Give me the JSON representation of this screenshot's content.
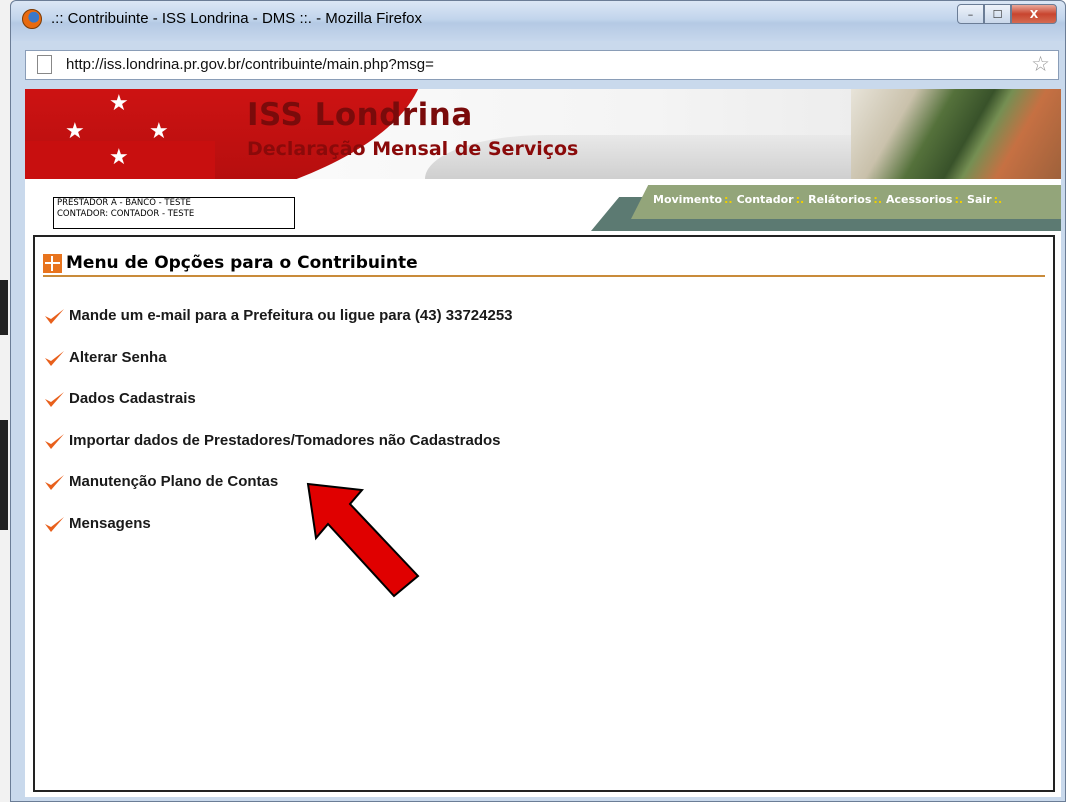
{
  "window": {
    "title": ".:: Contribuinte - ISS Londrina - DMS ::. - Mozilla Firefox",
    "min_label": "–",
    "max_label": "☐",
    "close_label": "X"
  },
  "address_bar": {
    "url": "http://iss.londrina.pr.gov.br/contribuinte/main.php?msg="
  },
  "banner": {
    "title": "ISS Londrina",
    "subtitle": "Declaração Mensal de Serviços"
  },
  "user_info": {
    "prestador": "PRESTADOR A - BANCO - TESTE",
    "contador": "CONTADOR: CONTADOR - TESTE"
  },
  "nav": {
    "items": [
      "Movimento",
      "Contador",
      "Relátorios",
      "Acessorios",
      "Sair"
    ],
    "separator": ":."
  },
  "menu": {
    "title": "Menu de Opções para o Contribuinte",
    "options": [
      "Mande um e-mail para a Prefeitura ou ligue para (43) 33724253",
      "Alterar Senha",
      "Dados Cadastrais",
      "Importar dados de Prestadores/Tomadores não Cadastrados",
      "Manutenção Plano de Contas",
      "Mensagens"
    ]
  },
  "colors": {
    "banner_red": "#c80f0f",
    "nav_green": "#93a57a",
    "check_orange": "#e8601c",
    "annotation_arrow": "#e00000"
  }
}
